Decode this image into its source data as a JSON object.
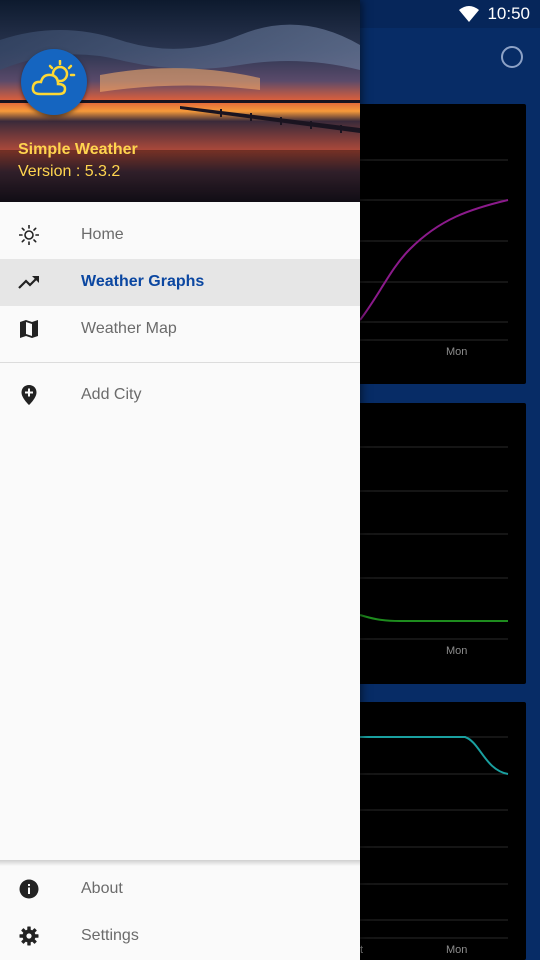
{
  "status_bar": {
    "time": "10:50",
    "wifi_icon": "wifi-icon"
  },
  "app_bar": {
    "refresh_icon": "refresh-circle-icon"
  },
  "background_charts": [
    {
      "axis_label": "Mon",
      "line_color": "#8b1a8b"
    },
    {
      "axis_label": "Mon",
      "line_color": "#1e8c1e"
    },
    {
      "axis_label": "Mon",
      "partial_label": "t",
      "line_color": "#1aa0a0"
    }
  ],
  "drawer": {
    "app_name": "Simple Weather",
    "version": "Version : 5.3.2",
    "logo_icon": "cloud-sun-icon",
    "nav_items": [
      {
        "label": "Home",
        "icon": "sun-icon",
        "active": false
      },
      {
        "label": "Weather Graphs",
        "icon": "trending-up-icon",
        "active": true
      },
      {
        "label": "Weather Map",
        "icon": "map-icon",
        "active": false
      }
    ],
    "secondary_items": [
      {
        "label": "Add City",
        "icon": "add-location-icon"
      }
    ],
    "bottom_items": [
      {
        "label": "About",
        "icon": "info-icon"
      },
      {
        "label": "Settings",
        "icon": "gear-icon"
      }
    ]
  },
  "colors": {
    "primary_dark": "#072c66",
    "accent_selected": "#0b47a1",
    "header_text": "#ffd54f",
    "logo_bg": "#1565c0"
  }
}
